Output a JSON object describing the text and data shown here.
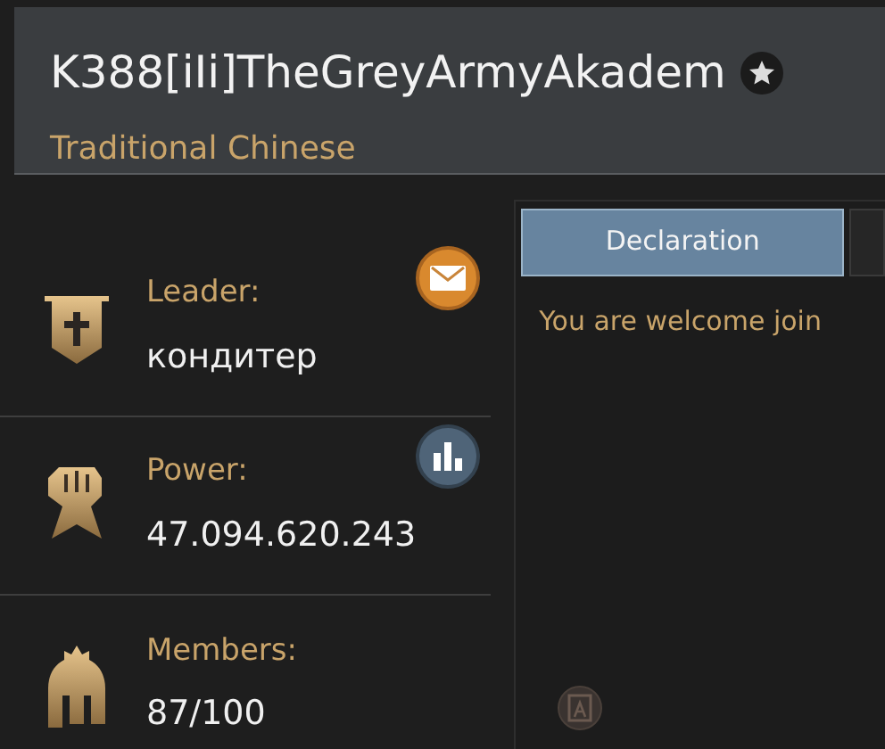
{
  "header": {
    "title": "K388[iIi]TheGreyArmyAkadem",
    "language": "Traditional Chinese"
  },
  "stats": [
    {
      "kind": "leader",
      "label": "Leader:",
      "value": "кондитер"
    },
    {
      "kind": "power",
      "label": "Power:",
      "value": "47.094.620.243"
    },
    {
      "kind": "members",
      "label": "Members:",
      "value": "87/100"
    }
  ],
  "tabs": [
    {
      "label": "Declaration",
      "selected": true
    }
  ],
  "declaration": "You are welcome join"
}
